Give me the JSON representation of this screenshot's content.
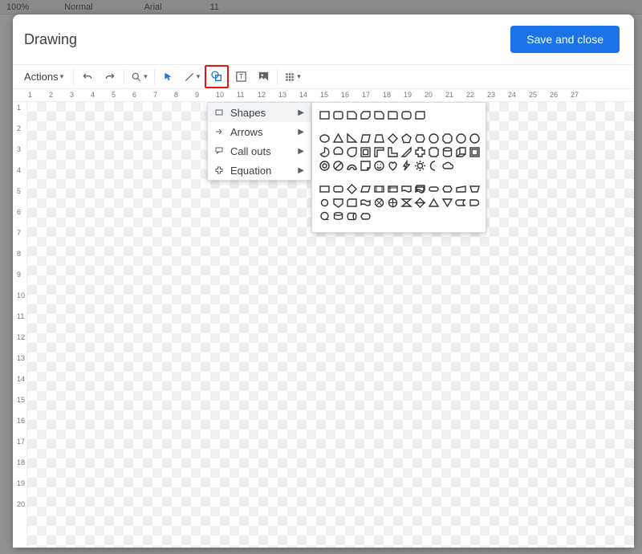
{
  "docs_toolbar": {
    "zoom": "100%",
    "style": "Normal",
    "font": "Arial",
    "size": "11"
  },
  "dialog": {
    "title": "Drawing",
    "save_label": "Save and close"
  },
  "drawing_toolbar": {
    "actions_label": "Actions"
  },
  "ruler_h": [
    "1",
    "2",
    "3",
    "4",
    "5",
    "6",
    "7",
    "8",
    "9",
    "10",
    "11",
    "12",
    "13",
    "14",
    "15",
    "16",
    "17",
    "18",
    "19",
    "20",
    "21",
    "22",
    "23",
    "24",
    "25",
    "26",
    "27"
  ],
  "ruler_v": [
    "1",
    "2",
    "3",
    "4",
    "5",
    "6",
    "7",
    "8",
    "9",
    "10",
    "11",
    "12",
    "13",
    "14",
    "15",
    "16",
    "17",
    "18",
    "19",
    "20"
  ],
  "shape_menu": {
    "items": [
      {
        "label": "Shapes",
        "icon": "rectangle"
      },
      {
        "label": "Arrows",
        "icon": "arrow"
      },
      {
        "label": "Call outs",
        "icon": "callout"
      },
      {
        "label": "Equation",
        "icon": "plus"
      }
    ]
  },
  "shapes_palette": {
    "group1": [
      [
        "rect",
        "round-rect",
        "snip1",
        "snip2",
        "snipround",
        "round1",
        "round2",
        "rounddiag"
      ]
    ],
    "group2": [
      [
        "ellipse",
        "triangle",
        "rtriangle",
        "parallelogram",
        "trapezoid",
        "diamond",
        "pentagon",
        "hexagon",
        "heptagon",
        "octagon",
        "decagon",
        "dodecagon"
      ],
      [
        "pie",
        "chord",
        "teardrop",
        "frame",
        "halfframe",
        "lshape",
        "diagstripe",
        "cross",
        "plaque",
        "can",
        "cube",
        "bevel"
      ],
      [
        "donut",
        "noentry",
        "blockarc",
        "foldcorner",
        "smiley",
        "heart",
        "lightning",
        "sun",
        "moon",
        "cloud"
      ]
    ],
    "group3": [
      [
        "process",
        "altprocess",
        "decision",
        "data",
        "predefined",
        "internal",
        "document",
        "multidoc",
        "terminator",
        "prep",
        "manualinput",
        "manualop"
      ],
      [
        "connector",
        "offpage",
        "card",
        "punchtape",
        "summing",
        "or",
        "collate",
        "sort",
        "extract",
        "merge",
        "storeddata",
        "delay"
      ],
      [
        "seqaccess",
        "magdisk",
        "directaccess",
        "display"
      ]
    ]
  }
}
